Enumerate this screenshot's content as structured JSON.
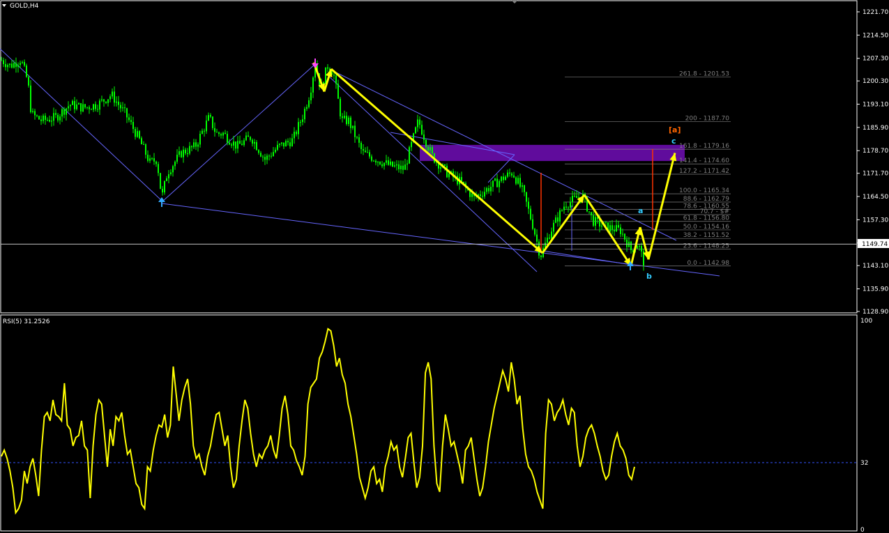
{
  "colors": {
    "background": "#000000",
    "frame": "#ffffff",
    "candle": "#00ff00",
    "wave": "#ffff00",
    "channel": "#6666ff",
    "zone": "#6a0dad",
    "fib": "#7f7f7f",
    "projection": "#ff3300",
    "rsi": "#ffff00",
    "wave_label": "#33ccff",
    "wave_label_main": "#ff6600"
  },
  "header": {
    "symbol": "GOLD,H4",
    "current_price_tag": "1149.74"
  },
  "rsi_panel": {
    "title": "RSI(5) 31.2526",
    "level_label": "32"
  },
  "wave_labels": {
    "main": "[a]",
    "a": "a",
    "b": "b",
    "c": "c"
  },
  "chart_data": [
    {
      "type": "candlestick",
      "title": "GOLD,H4",
      "ylim": [
        1128.9,
        1221.7
      ],
      "y_ticks": [
        "1221.70",
        "1214.50",
        "1207.30",
        "1200.30",
        "1193.10",
        "1185.90",
        "1178.70",
        "1171.70",
        "1164.50",
        "1157.30",
        "1150.10",
        "1143.10",
        "1135.90",
        "1128.90"
      ],
      "current_price": 1149.74,
      "approx_close_path": {
        "x": [
          0,
          15,
          30,
          40,
          45,
          60,
          80,
          100,
          120,
          140,
          160,
          180,
          200,
          215,
          225,
          232,
          240,
          260,
          280,
          300,
          310,
          320,
          340,
          360,
          380,
          400,
          420,
          435,
          445,
          452,
          460,
          470,
          478,
          490,
          500,
          520,
          540,
          560,
          580,
          600,
          610,
          620,
          640,
          660,
          680,
          700,
          720,
          735,
          750,
          765,
          775,
          790,
          810,
          835,
          850,
          870,
          890,
          905,
          915,
          925
        ],
        "y": [
          1207,
          1205,
          1207,
          1200,
          1190,
          1188,
          1189,
          1193,
          1192,
          1193,
          1196,
          1190,
          1182,
          1175,
          1176,
          1164,
          1172,
          1178,
          1180,
          1189,
          1184,
          1184,
          1180,
          1183,
          1176,
          1180,
          1182,
          1190,
          1197,
          1206,
          1198,
          1205,
          1203,
          1188,
          1188,
          1178,
          1176,
          1174,
          1173,
          1188,
          1182,
          1177,
          1172,
          1169,
          1164,
          1167,
          1170,
          1172,
          1166,
          1155,
          1146,
          1154,
          1162,
          1165,
          1157,
          1155,
          1154,
          1148,
          1150,
          1143
        ]
      },
      "fibonacci_levels": [
        {
          "label": "261.8 - 1201.53",
          "value": 1201.53
        },
        {
          "label": "200 - 1187.70",
          "value": 1187.7
        },
        {
          "label": "161.8 - 1179.16",
          "value": 1179.16
        },
        {
          "label": "141.4 - 1174.60",
          "value": 1174.6
        },
        {
          "label": "127.2 - 1171.42",
          "value": 1171.42
        },
        {
          "label": "100.0 - 1165.34",
          "value": 1165.34
        },
        {
          "label": "88.6 - 1162.79",
          "value": 1162.79
        },
        {
          "label": "78.6 - 1160.55",
          "value": 1160.55
        },
        {
          "label": "70.7 - $#",
          "value": 1158.9
        },
        {
          "label": "61.8 - 1156.80",
          "value": 1156.8
        },
        {
          "label": "50.0 - 1154.16",
          "value": 1154.16
        },
        {
          "label": "38.2 - 1151.52",
          "value": 1151.52
        },
        {
          "label": "23.6 - 1148.25",
          "value": 1148.25
        },
        {
          "label": "0.0 - 1142.98",
          "value": 1142.98
        }
      ],
      "supply_zone": {
        "y_top": 1180.5,
        "y_bottom": 1175.5
      },
      "wave_path": {
        "x": [
          450,
          465,
          475,
          778,
          838,
          905,
          918,
          930,
          968
        ],
        "y": [
          1206,
          1197,
          1204,
          1147,
          1165,
          1143,
          1155,
          1145,
          1178
        ]
      }
    },
    {
      "type": "line",
      "title": "RSI(5) 31.2526",
      "ylim": [
        0,
        100
      ],
      "y_ticks": [
        "100",
        "32",
        "0"
      ],
      "reference_level": 32,
      "series": [
        {
          "values": [
            35,
            38,
            34,
            28,
            20,
            8,
            10,
            14,
            28,
            22,
            30,
            34,
            26,
            16,
            38,
            54,
            56,
            52,
            62,
            55,
            54,
            52,
            70,
            50,
            48,
            40,
            44,
            45,
            52,
            40,
            38,
            15,
            40,
            55,
            62,
            60,
            45,
            30,
            48,
            40,
            54,
            52,
            56,
            45,
            36,
            38,
            30,
            22,
            20,
            12,
            10,
            30,
            28,
            38,
            45,
            50,
            49,
            55,
            44,
            50,
            78,
            65,
            52,
            62,
            68,
            72,
            60,
            40,
            34,
            36,
            30,
            26,
            35,
            40,
            48,
            55,
            56,
            48,
            40,
            45,
            30,
            20,
            24,
            40,
            52,
            62,
            58,
            46,
            36,
            30,
            36,
            34,
            38,
            40,
            45,
            38,
            34,
            45,
            58,
            64,
            55,
            40,
            38,
            33,
            30,
            26,
            35,
            60,
            68,
            70,
            72,
            82,
            85,
            90,
            96,
            95,
            88,
            78,
            82,
            74,
            70,
            60,
            54,
            45,
            36,
            25,
            20,
            15,
            20,
            28,
            30,
            22,
            24,
            18,
            30,
            35,
            42,
            38,
            40,
            30,
            25,
            34,
            44,
            46,
            32,
            20,
            25,
            40,
            75,
            80,
            72,
            40,
            22,
            18,
            40,
            55,
            48,
            40,
            42,
            36,
            30,
            22,
            38,
            40,
            44,
            34,
            24,
            16,
            20,
            30,
            42,
            50,
            58,
            64,
            70,
            76,
            72,
            66,
            80,
            72,
            60,
            64,
            48,
            36,
            30,
            28,
            24,
            18,
            14,
            10,
            46,
            62,
            60,
            52,
            56,
            58,
            62,
            55,
            50,
            58,
            56,
            40,
            30,
            35,
            44,
            48,
            50,
            46,
            40,
            35,
            28,
            24,
            26,
            35,
            42,
            46,
            40,
            38,
            34,
            26,
            24,
            30
          ]
        }
      ]
    }
  ]
}
